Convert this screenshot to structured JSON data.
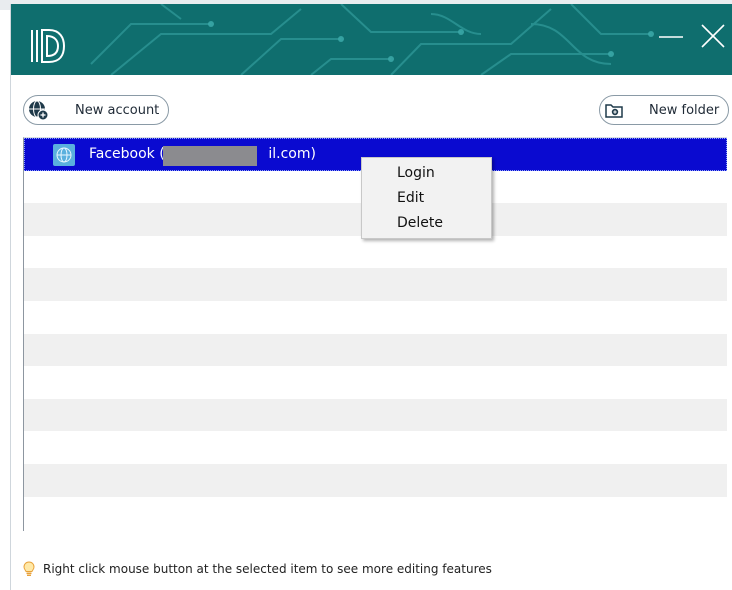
{
  "window": {
    "minimize_icon": "minimize-icon",
    "close_icon": "close-icon",
    "header_color": "#0f6e6e"
  },
  "toolbar": {
    "new_account_label": "New account",
    "new_account_icon": "globe-plus-icon",
    "new_folder_label": "New folder",
    "new_folder_icon": "folder-plus-icon"
  },
  "accounts": [
    {
      "text_start": "Facebook (r",
      "text_end": "il.com)",
      "icon": "globe-icon",
      "selected": true,
      "redacted": true
    }
  ],
  "context_menu": {
    "items": [
      "Login",
      "Edit",
      "Delete"
    ]
  },
  "hint": {
    "icon": "lightbulb-icon",
    "text": "Right click mouse button at the selected item to see more editing features"
  },
  "colors": {
    "selection": "#0a0ad0",
    "alt_row": "#f0f0f0",
    "globe": "#5ab0de"
  }
}
